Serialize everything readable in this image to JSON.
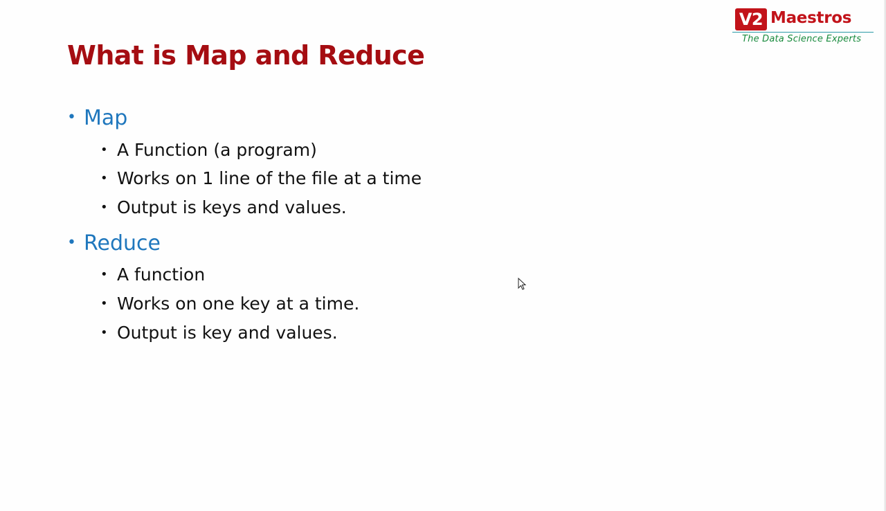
{
  "slide": {
    "title": "What is Map and Reduce",
    "logo": {
      "badge": "V2",
      "name": "Maestros",
      "tagline": "The Data Science Experts"
    },
    "sections": [
      {
        "heading": "Map",
        "items": [
          "A Function (a program)",
          "Works on 1 line of the file at a time",
          "Output is keys and values."
        ]
      },
      {
        "heading": "Reduce",
        "items": [
          "A function",
          "Works on one key at a time.",
          "Output is key and values."
        ]
      }
    ]
  },
  "colors": {
    "title": "#a50d12",
    "heading": "#1f77bd",
    "body": "#111111",
    "logo_red": "#c2131a",
    "logo_green": "#178a3c"
  },
  "icons": [
    "mouse-pointer-icon"
  ]
}
